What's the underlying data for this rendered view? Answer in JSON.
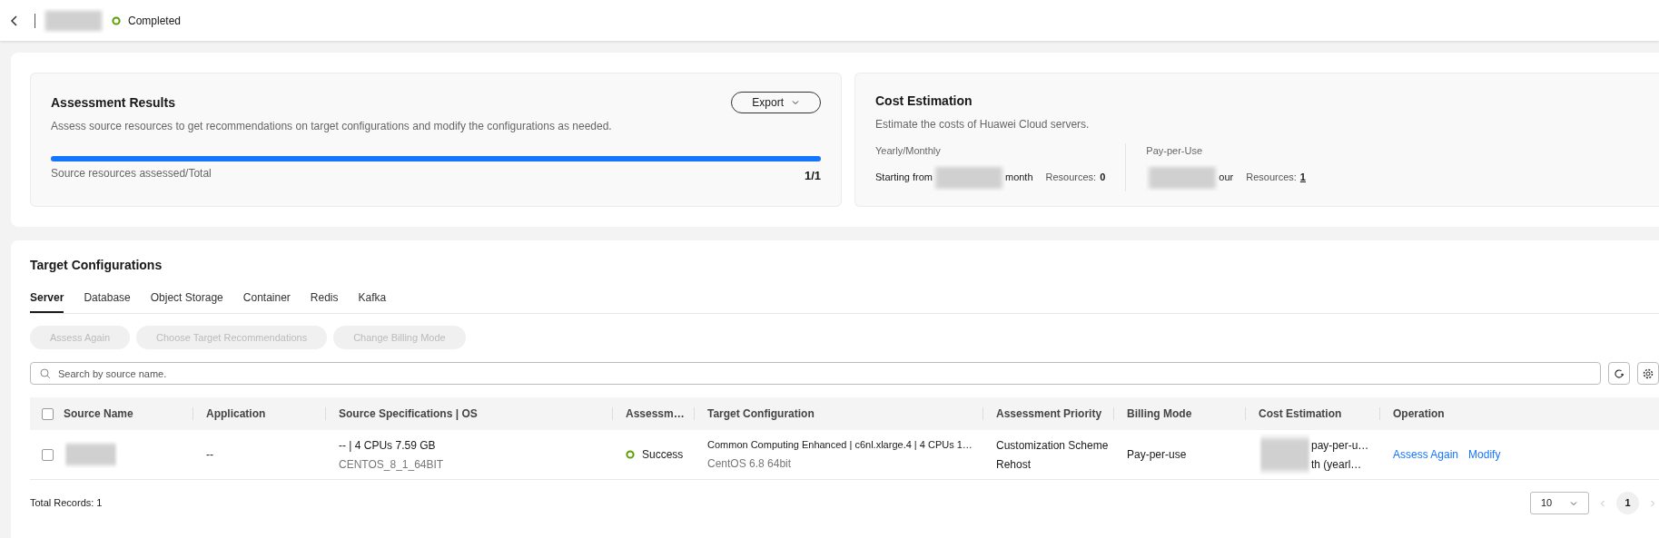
{
  "header": {
    "status": "Completed"
  },
  "assessment": {
    "title": "Assessment Results",
    "description": "Assess source resources to get recommendations on target configurations and modify the configurations as needed.",
    "export_button": "Export",
    "progress": {
      "label": "Source resources assessed/Total",
      "reading": "1/1",
      "level": 1
    }
  },
  "cost": {
    "title": "Cost Estimation",
    "description": "Estimate the costs of Huawei Cloud servers.",
    "groups": [
      {
        "label": "Yearly/Monthly",
        "prefix": "Starting from",
        "suffix": "month",
        "resources_label": "Resources:",
        "resources_value": "0",
        "link": false
      },
      {
        "label": "Pay-per-Use",
        "suffix": "our",
        "resources_label": "Resources:",
        "resources_value": "1",
        "link": true
      }
    ]
  },
  "target": {
    "title": "Target Configurations",
    "tabs": [
      {
        "label": "Server",
        "selected": true
      },
      {
        "label": "Database",
        "selected": false
      },
      {
        "label": "Object Storage",
        "selected": false
      },
      {
        "label": "Container",
        "selected": false
      },
      {
        "label": "Redis",
        "selected": false
      },
      {
        "label": "Kafka",
        "selected": false
      }
    ],
    "actions": [
      {
        "label": "Assess Again",
        "disabled": true
      },
      {
        "label": "Choose Target Recommendations",
        "disabled": true
      },
      {
        "label": "Change Billing Mode",
        "disabled": true
      }
    ],
    "search": {
      "placeholder": "Search by source name."
    },
    "table": {
      "select_all_checked": false,
      "columns": [
        "Source Name",
        "Application",
        "Source Specifications | OS",
        "Assessm…",
        "Target Configuration",
        "Assessment Priority",
        "Billing Mode",
        "Cost Estimation",
        "Operation"
      ],
      "rows": [
        {
          "checked": false,
          "application": "--",
          "spec": "-- | 4 CPUs 7.59 GB",
          "os": "CENTOS_8_1_64BIT",
          "status": "Success",
          "target": "Common Computing Enhanced | c6nl.xlarge.4 | 4 CPUs 1…",
          "target_os": "CentOS 6.8 64bit",
          "priority": [
            "Customization Scheme",
            "Rehost"
          ],
          "billing": "Pay-per-use",
          "cost": [
            "pay-per-u…",
            "th (yearl…"
          ],
          "operations": [
            "Assess Again",
            "Modify"
          ]
        }
      ]
    },
    "footer": {
      "total": "Total Records: 1",
      "page_size": "10",
      "page": "1"
    }
  }
}
